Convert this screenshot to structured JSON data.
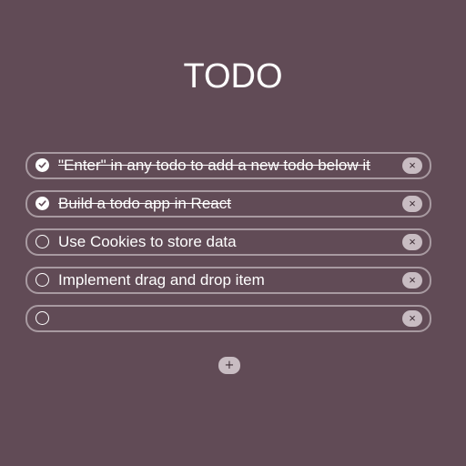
{
  "title": "TODO",
  "todos": [
    {
      "text": "\"Enter\" in any todo to add a new todo below it",
      "done": true
    },
    {
      "text": "Build a todo app in React",
      "done": true
    },
    {
      "text": "Use Cookies to store data",
      "done": false
    },
    {
      "text": "Implement drag and drop item",
      "done": false
    },
    {
      "text": "",
      "done": false
    }
  ],
  "icons": {
    "check": "checkmark-icon",
    "delete": "close-icon",
    "add": "plus-icon"
  },
  "labels": {
    "delete": "×",
    "add": "+"
  },
  "colors": {
    "background": "#614b56",
    "item_border": "#a89aa1",
    "button_bg": "#c8bcc2"
  }
}
